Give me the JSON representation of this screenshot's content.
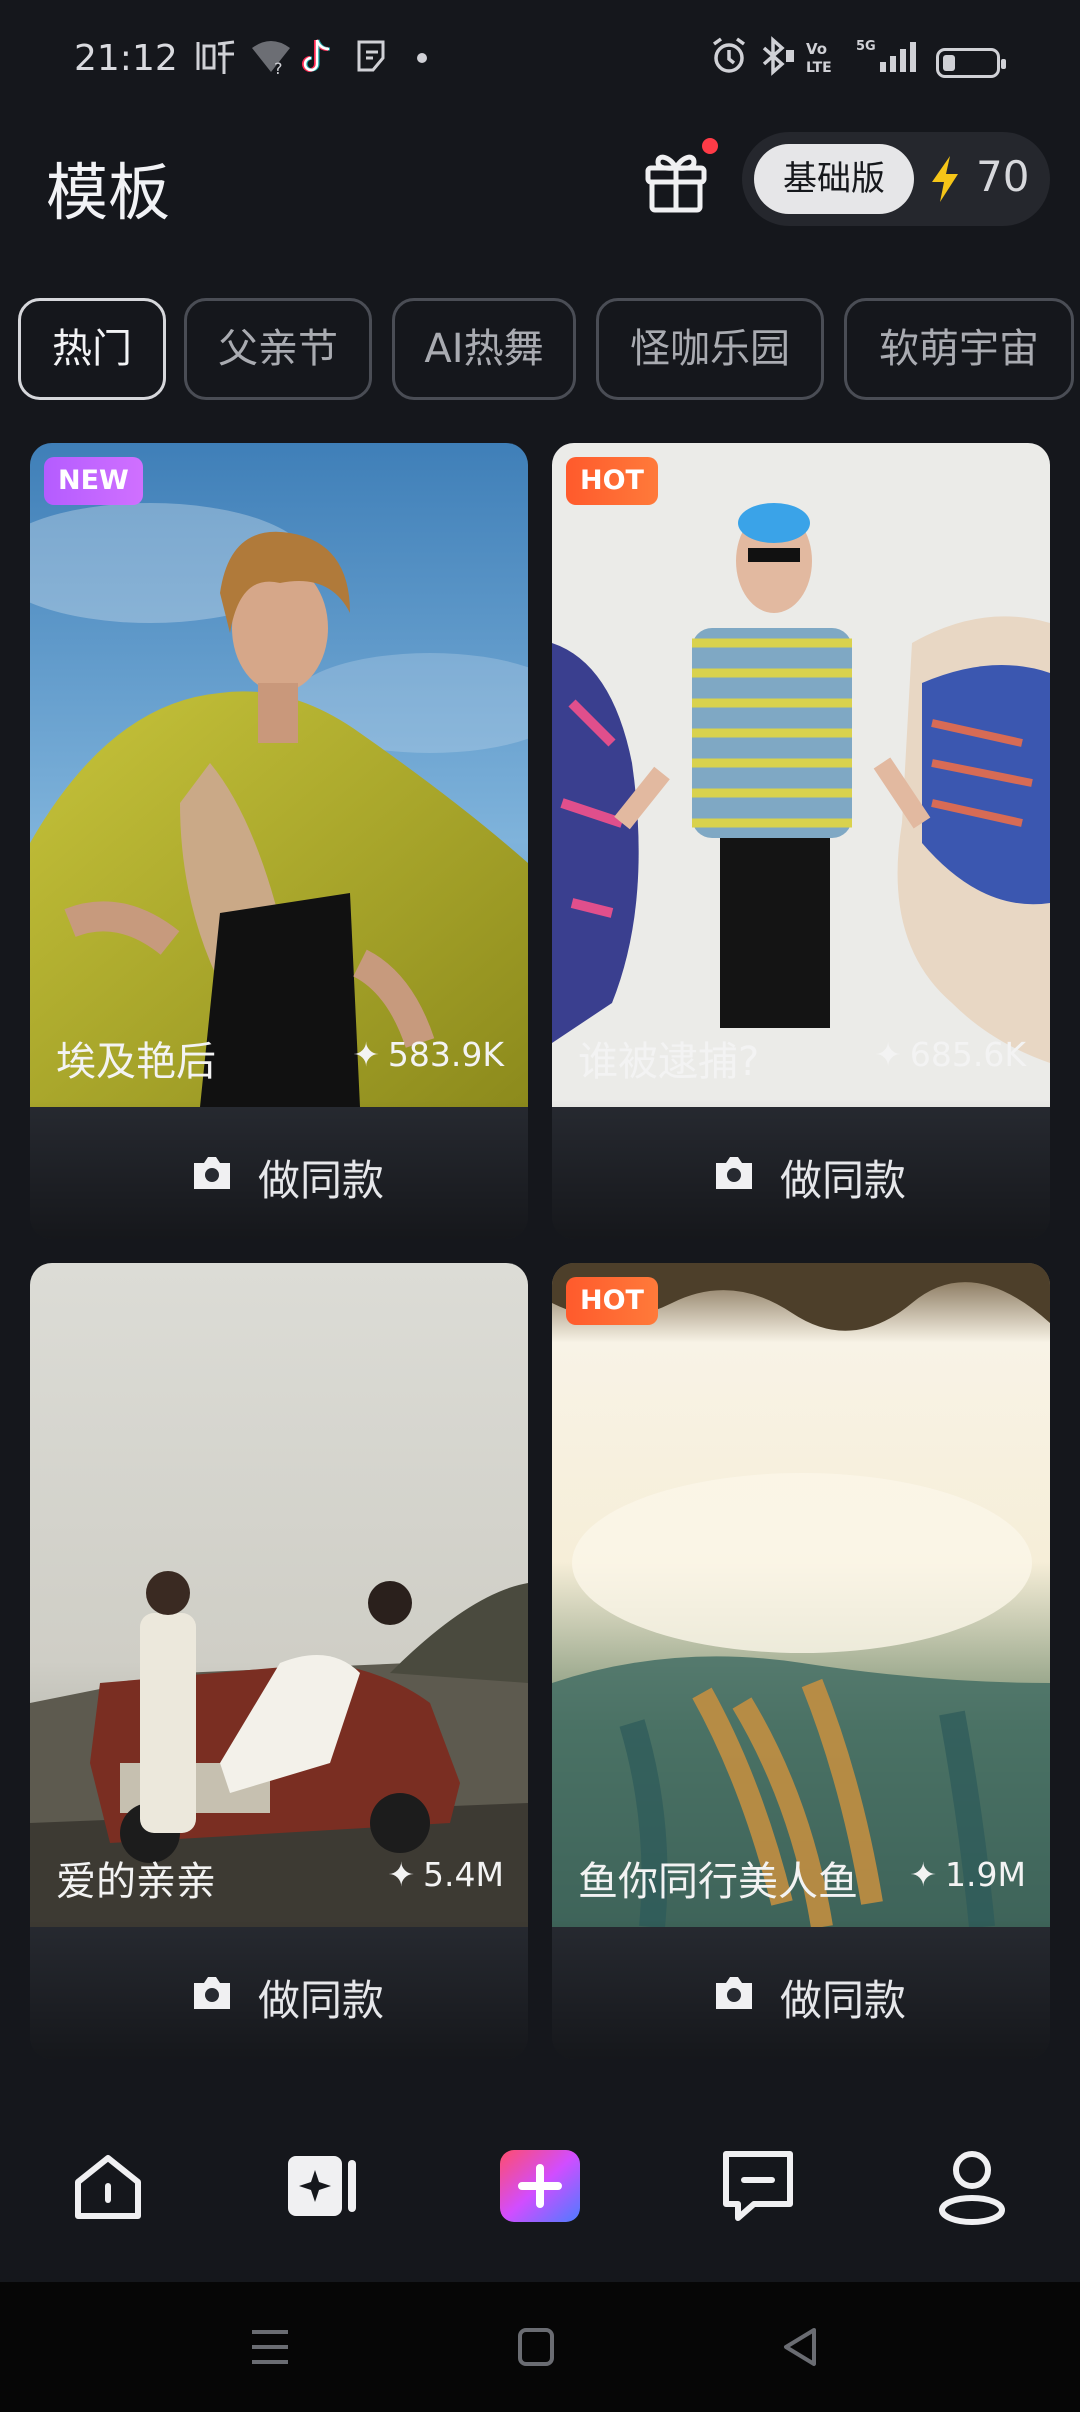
{
  "status_bar": {
    "time": "21:12",
    "icons": [
      "listen-app-icon",
      "wifi-question-icon",
      "tiktok-icon",
      "sticker-icon",
      "dot-icon",
      "alarm-icon",
      "bluetooth-icon",
      "volte-icon",
      "5g-signal-icon",
      "battery-icon"
    ]
  },
  "header": {
    "title": "模板",
    "plan_label": "基础版",
    "credits": "70",
    "accent": "#f5c518"
  },
  "tabs": [
    "热门",
    "父亲节",
    "AI热舞",
    "怪咖乐园",
    "软萌宇宙"
  ],
  "cards": [
    {
      "badge": "NEW",
      "name": "埃及艳后",
      "count": "583.9K",
      "action": "做同款"
    },
    {
      "badge": "HOT",
      "name": "谁被逮捕?",
      "count": "685.6K",
      "action": "做同款"
    },
    {
      "badge": "",
      "name": "爱的亲亲",
      "count": "5.4M",
      "action": "做同款"
    },
    {
      "badge": "HOT",
      "name": "鱼你同行美人鱼",
      "count": "1.9M",
      "action": "做同款"
    }
  ],
  "nav": [
    "home-icon",
    "ai-video-icon",
    "create-plus-icon",
    "message-icon",
    "profile-icon"
  ],
  "colors": {
    "bg": "#15171c",
    "card": "#272a31",
    "new_badge": "#c465ff",
    "hot_badge": "#ff6030"
  }
}
